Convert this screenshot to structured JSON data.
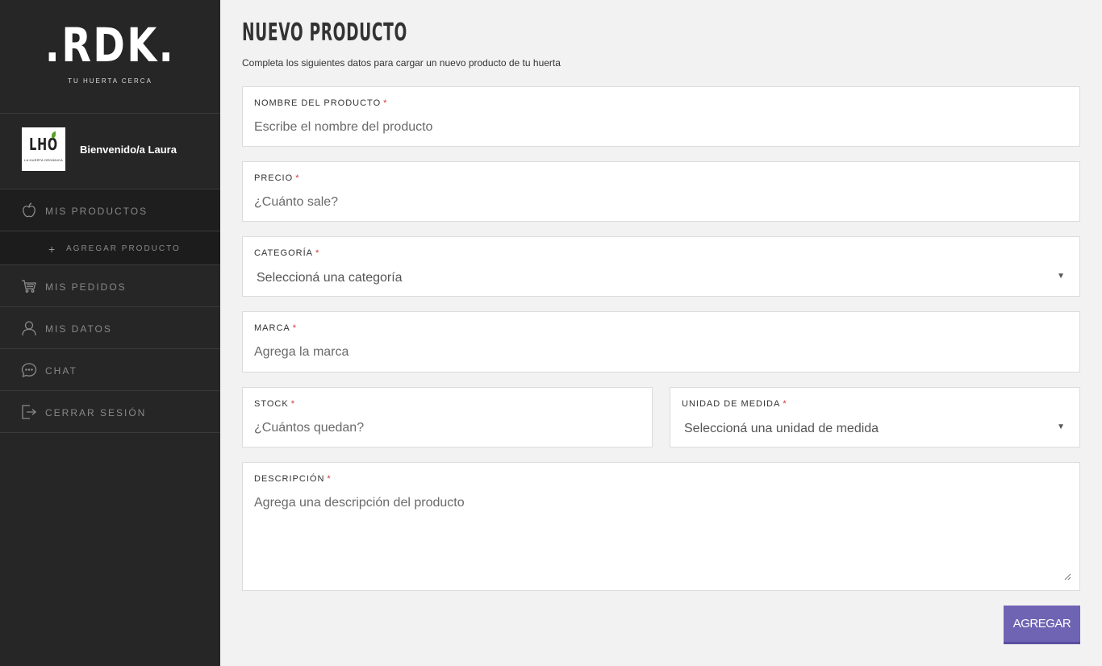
{
  "brand": {
    "logo_text": ".RDK.",
    "tagline": "TU HUERTA CERCA"
  },
  "user": {
    "avatar_text": "LHO",
    "avatar_subtext": "LA HUERTA ORGÁNICA",
    "welcome": "Bienvenido/a Laura"
  },
  "nav": {
    "mis_productos": "MIS PRODUCTOS",
    "agregar_producto": "AGREGAR PRODUCTO",
    "agregar_plus": "+",
    "mis_pedidos": "MIS PEDIDOS",
    "mis_datos": "MIS DATOS",
    "chat": "CHAT",
    "cerrar_sesion": "CERRAR SESIÓN"
  },
  "page": {
    "title": "NUEVO PRODUCTO",
    "subtitle": "Completa los siguientes datos para cargar un nuevo producto de tu huerta"
  },
  "form": {
    "required_mark": "*",
    "nombre": {
      "label": "NOMBRE DEL PRODUCTO",
      "placeholder": "Escribe el nombre del producto"
    },
    "precio": {
      "label": "PRECIO",
      "placeholder": "¿Cuánto sale?"
    },
    "categoria": {
      "label": "CATEGORÍA",
      "selected": "Seleccioná una categoría"
    },
    "marca": {
      "label": "MARCA",
      "placeholder": "Agrega la marca"
    },
    "stock": {
      "label": "STOCK",
      "placeholder": "¿Cuántos quedan?"
    },
    "unidad": {
      "label": "UNIDAD DE MEDIDA",
      "selected": "Seleccioná una unidad de medida"
    },
    "descripcion": {
      "label": "DESCRIPCIÓN",
      "placeholder": "Agrega una descripción del producto"
    },
    "submit_label": "AGREGAR",
    "dropdown_arrow": "▼"
  },
  "colors": {
    "sidebar_bg": "#262626",
    "accent": "#6f63b3",
    "required": "#d9302f",
    "page_bg": "#f2f2f2"
  }
}
